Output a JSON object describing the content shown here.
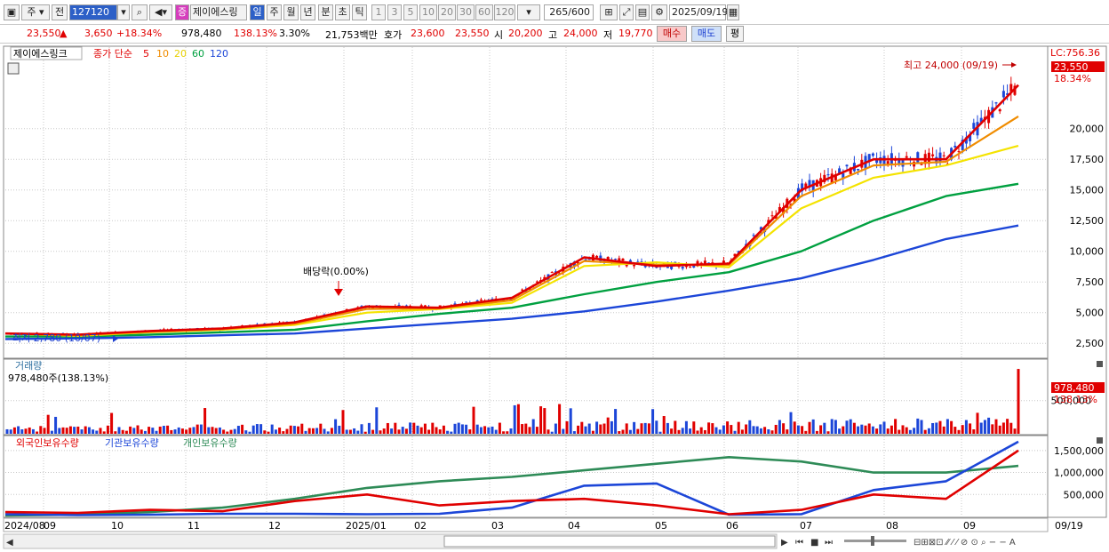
{
  "toolbar": {
    "period_sel": "주",
    "prev_btn": "전",
    "code_value": "127120",
    "stock_badge": "증",
    "stock_name": "제이에스링",
    "period_tabs": [
      "일",
      "주",
      "월",
      "년",
      "분",
      "초",
      "틱"
    ],
    "interval_buttons": [
      "1",
      "3",
      "5",
      "10",
      "20",
      "30",
      "60",
      "120"
    ],
    "count_display": "265/600",
    "date_value": "2025/09/19"
  },
  "quote": {
    "price": "23,550",
    "change": "3,650",
    "change_pct": "+18.34%",
    "volume": "978,480",
    "volume_ratio": "138.13%",
    "turnover": "3.30%",
    "amount": "21,753백만",
    "bid_label": "호가",
    "ask": "23,600",
    "bid": "23,550",
    "open_label": "시",
    "open": "20,200",
    "high_label": "고",
    "high": "24,000",
    "low_label": "저",
    "low": "19,770",
    "buy_btn": "매수",
    "sell_btn": "매도",
    "eval_btn": "평"
  },
  "price_panel": {
    "title": "제이에스링크",
    "ma_label": "종가 단순",
    "ma_periods": [
      "5",
      "10",
      "20",
      "60",
      "120"
    ],
    "ma_colors": [
      "#e00000",
      "#f08c00",
      "#f4e300",
      "#00a040",
      "#1c46d8"
    ],
    "lc_label": "LC:756.36",
    "last_price_tag": "23,550",
    "last_pct_tag": "18.34%",
    "high_annotation": "최고 24,000 (09/19)",
    "low_annotation": "최저 2,780 (10/07)",
    "dividend_annotation": "배당락(0.00%)"
  },
  "volume_panel": {
    "title": "거래량",
    "value_label": "978,480주(138.13%)",
    "tag_value": "978,480",
    "tag_pct": "138.13%"
  },
  "holding_panel": {
    "legend": [
      "외국인보유수량",
      "기관보유수량",
      "개인보유수량"
    ],
    "legend_colors": [
      "#e00000",
      "#1c46d8",
      "#2e8b57"
    ]
  },
  "xaxis": {
    "labels": [
      "2024/08",
      "09",
      "10",
      "11",
      "12",
      "2025/01",
      "02",
      "03",
      "04",
      "05",
      "06",
      "07",
      "08",
      "09"
    ],
    "right_date": "09/19"
  },
  "chart_data": [
    {
      "type": "line",
      "title": "제이에스링크",
      "ylabel": "",
      "ylim": [
        1500,
        26500
      ],
      "yticks": [
        "2,500",
        "5,000",
        "7,500",
        "10,000",
        "12,500",
        "15,000",
        "17,500",
        "20,000"
      ],
      "x": [
        "2024/08",
        "09",
        "10",
        "11",
        "12",
        "2025/01",
        "02",
        "03",
        "04",
        "05",
        "06",
        "07",
        "08",
        "09",
        "09/19"
      ],
      "series": [
        {
          "name": "5",
          "values": [
            3300,
            3200,
            3500,
            3700,
            4200,
            5500,
            5400,
            6200,
            9500,
            8800,
            9000,
            15000,
            17500,
            17500,
            23550
          ]
        },
        {
          "name": "10",
          "values": [
            3300,
            3150,
            3450,
            3650,
            4100,
            5300,
            5350,
            6000,
            9200,
            8900,
            8900,
            14500,
            17000,
            17300,
            21000
          ]
        },
        {
          "name": "20",
          "values": [
            3300,
            3100,
            3400,
            3600,
            4000,
            5000,
            5300,
            5800,
            8800,
            9100,
            8700,
            13500,
            16000,
            17000,
            18600
          ]
        },
        {
          "name": "60",
          "values": [
            3050,
            3050,
            3200,
            3400,
            3600,
            4300,
            4900,
            5400,
            6500,
            7500,
            8300,
            10000,
            12500,
            14500,
            15500
          ]
        },
        {
          "name": "120",
          "values": [
            2850,
            2900,
            3000,
            3150,
            3300,
            3700,
            4100,
            4500,
            5100,
            5900,
            6800,
            7800,
            9300,
            11000,
            12100
          ]
        }
      ]
    },
    {
      "type": "bar",
      "title": "거래량",
      "ylim": [
        0,
        1100000
      ],
      "yticks": [
        "500,000"
      ],
      "last_value": 978480
    },
    {
      "type": "line",
      "title": "외국인보유수량 / 기관보유수량 / 개인보유수량",
      "ylim": [
        0,
        1800000
      ],
      "yticks": [
        "500,000",
        "1,000,000",
        "1,500,000"
      ],
      "x": [
        "2024/08",
        "09",
        "10",
        "11",
        "12",
        "2025/01",
        "02",
        "03",
        "04",
        "05",
        "06",
        "07",
        "08",
        "09",
        "09/19"
      ],
      "series": [
        {
          "name": "외국인보유수량",
          "values": [
            100000,
            80000,
            150000,
            120000,
            350000,
            500000,
            250000,
            350000,
            400000,
            250000,
            50000,
            150000,
            500000,
            400000,
            1500000
          ]
        },
        {
          "name": "기관보유수량",
          "values": [
            50000,
            30000,
            40000,
            60000,
            60000,
            50000,
            60000,
            200000,
            700000,
            750000,
            40000,
            50000,
            600000,
            800000,
            1700000
          ]
        },
        {
          "name": "개인보유수량",
          "values": [
            20000,
            40000,
            100000,
            200000,
            400000,
            650000,
            800000,
            900000,
            1050000,
            1200000,
            1350000,
            1250000,
            1000000,
            1000000,
            1150000
          ]
        }
      ]
    }
  ]
}
